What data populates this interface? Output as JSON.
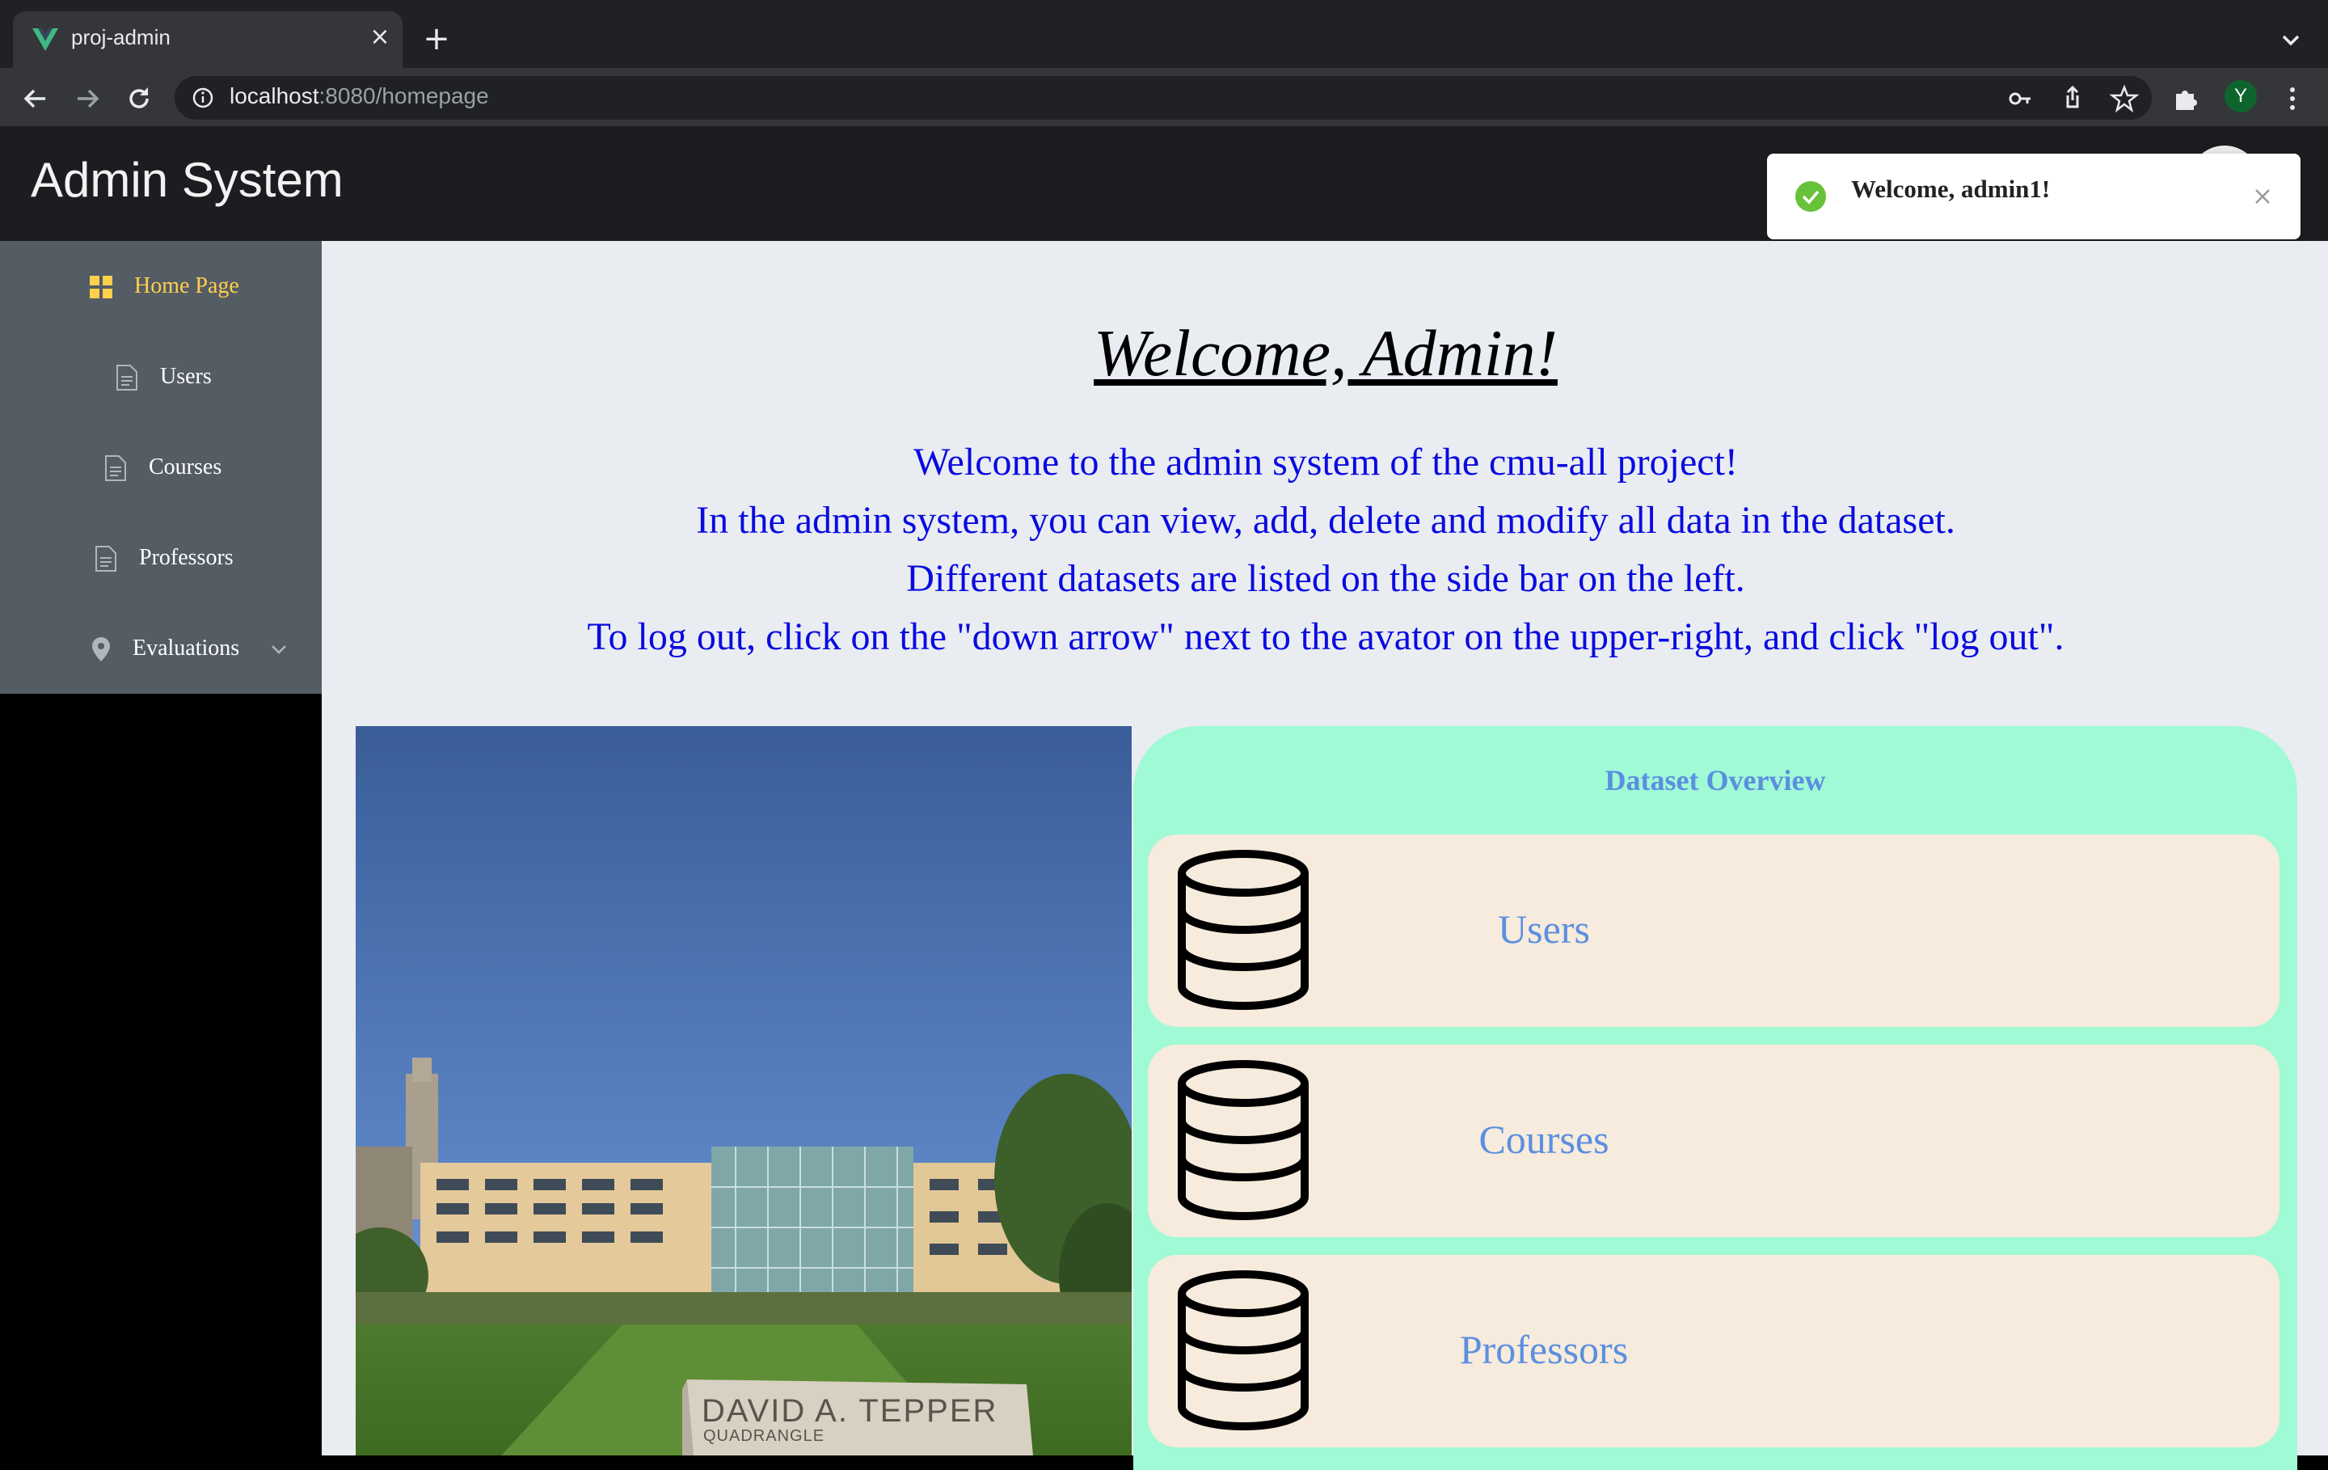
{
  "browser": {
    "tab_title": "proj-admin",
    "tab_close": "×",
    "new_tab": "+",
    "url_host": "localhost",
    "url_path": ":8080/homepage",
    "profile_initial": "Y"
  },
  "app": {
    "title": "Admin System"
  },
  "toast": {
    "message": "Welcome, admin1!"
  },
  "sidebar": {
    "items": [
      {
        "label": "Home Page",
        "icon": "grid-icon",
        "active": true
      },
      {
        "label": "Users",
        "icon": "document-icon"
      },
      {
        "label": "Courses",
        "icon": "document-icon"
      },
      {
        "label": "Professors",
        "icon": "document-icon"
      },
      {
        "label": "Evaluations",
        "icon": "location-pin-icon",
        "expandable": true
      }
    ]
  },
  "main": {
    "heading": "Welcome, Admin!",
    "intro": [
      "Welcome to the admin system of the cmu-all project!",
      "In the admin system, you can view, add, delete and modify all data in the dataset.",
      "Different datasets are listed on the side bar on the left.",
      "To log out, click on the \"down arrow\" next to the avator on the upper-right, and click \"log out\"."
    ]
  },
  "photo": {
    "sign_title": "DAVID A. TEPPER",
    "sign_subtitle": "QUADRANGLE"
  },
  "overview": {
    "title": "Dataset Overview",
    "cards": [
      {
        "label": "Users",
        "icon": "database-icon"
      },
      {
        "label": "Courses",
        "icon": "database-icon"
      },
      {
        "label": "Professors",
        "icon": "database-icon"
      }
    ]
  },
  "colors": {
    "sidebar_bg": "#545c64",
    "sidebar_active": "#ffd04b",
    "intro_text": "#0a0ae0",
    "overview_bg": "#9ffad5",
    "card_bg": "#f6ebdc",
    "card_text": "#5b8fe0",
    "toast_success": "#67c23a"
  }
}
